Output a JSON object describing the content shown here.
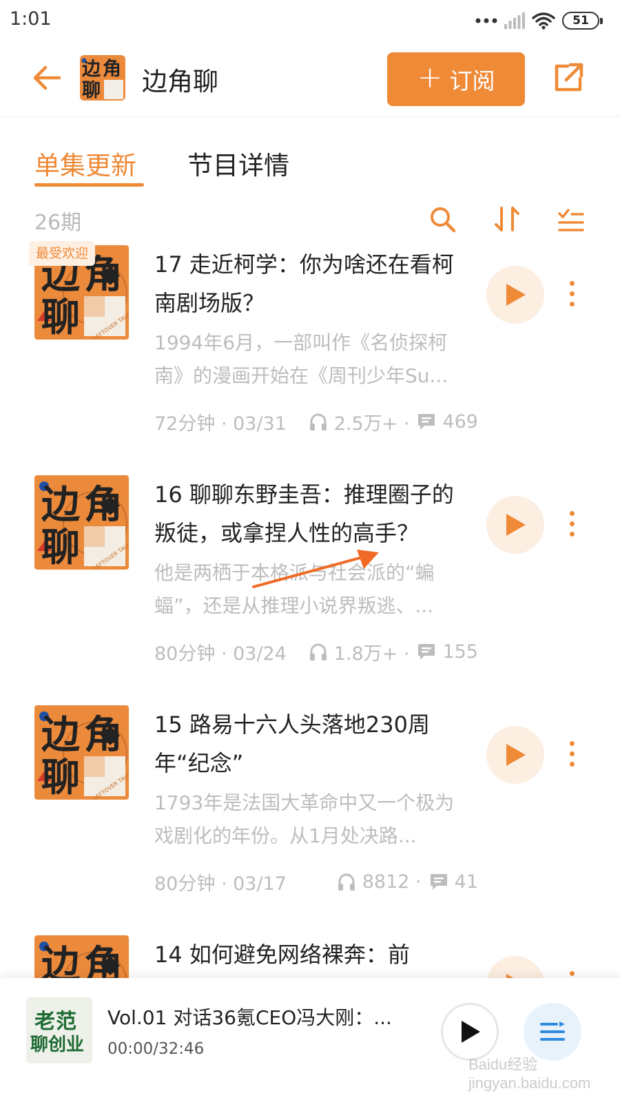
{
  "status_bar": {
    "time": "1:01",
    "battery": "51"
  },
  "header": {
    "title": "边角聊",
    "subscribe_label": "订阅",
    "thumb_text": [
      "边",
      "角",
      "聊"
    ]
  },
  "tabs": [
    {
      "label": "单集更新",
      "active": true
    },
    {
      "label": "节目详情",
      "active": false
    }
  ],
  "toolbar": {
    "episode_count": "26期"
  },
  "cover_text": {
    "c1": "边",
    "c2": "角",
    "c3": "聊",
    "small": "LEFTOVER TALK"
  },
  "episodes": [
    {
      "badge": "最受欢迎",
      "title": "17 走近柯学：你为啥还在看柯南剧场版？",
      "desc": "1994年6月，一部叫作《名侦探柯南》的漫画开始在《周刊少年Su...",
      "duration_date": "72分钟 · 03/31",
      "plays": "2.5万+ ·",
      "comments": "469"
    },
    {
      "title": "16 聊聊东野圭吾：推理圈子的叛徒，或拿捏人性的高手？",
      "desc": "他是两栖于本格派与社会派的“蝙蝠”，还是从推理小说界叛逃、...",
      "duration_date": "80分钟 · 03/24",
      "plays": "1.8万+ ·",
      "comments": "155"
    },
    {
      "title": "15 路易十六人头落地230周年“纪念”",
      "desc": "1793年是法国大革命中又一个极为戏剧化的年份。从1月处决路...",
      "duration_date": "80分钟 · 03/17",
      "plays": "8812 ·",
      "comments": "41"
    },
    {
      "title": "14 如何避免网络裸奔：前",
      "desc": "",
      "duration_date": "",
      "plays": "",
      "comments": ""
    }
  ],
  "mini_player": {
    "title": "Vol.01 对话36氪CEO冯大刚：...",
    "time": "00:00/32:46",
    "cover_line1": "老范",
    "cover_line2": "聊创业"
  },
  "watermark": "Baidu经验 jingyan.baidu.com",
  "colors": {
    "accent": "#ef8a37",
    "cover_orange": "#ec8a3c",
    "cover_dark": "#222222",
    "muted": "#bdbdbd"
  }
}
